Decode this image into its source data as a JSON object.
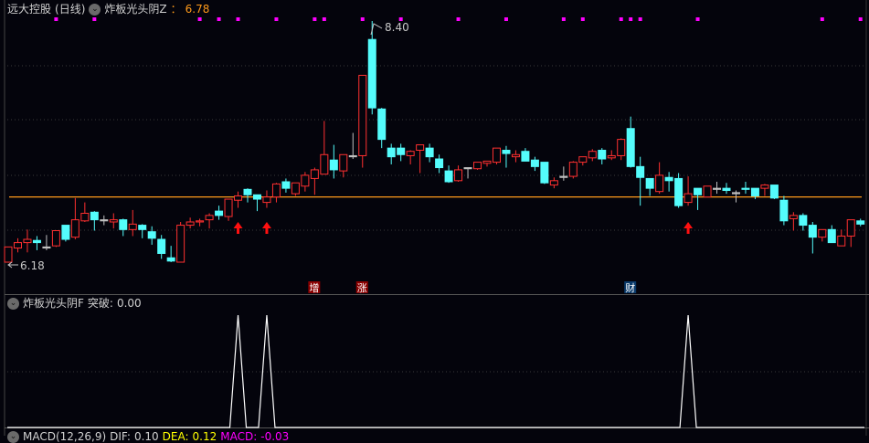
{
  "header": {
    "stock": "远大控股",
    "period": "(日线)",
    "indicator": "炸板光头阴Z",
    "sep": "：",
    "value": "6.78"
  },
  "lower": {
    "indicator": "炸板光头阴F",
    "label": "突破:",
    "value": "0.00"
  },
  "macd": {
    "name": "MACD(12,26,9)",
    "dif_label": "DIF:",
    "dif": "0.10",
    "dea_label": "DEA:",
    "dea": "0.12",
    "macd_label": "MACD:",
    "macd": "-0.03"
  },
  "chart_data": {
    "type": "candlestick",
    "ylim": [
      6.18,
      8.4
    ],
    "max_label": "8.40",
    "min_label": "6.18",
    "reference_line": 6.78,
    "colors": {
      "up": "#ff3030",
      "down": "#54fcfc",
      "doji": "#c0c0c0",
      "ref": "#ff9a1a",
      "dot": "#ff00ff",
      "arrow": "#ff1010",
      "signal": "#ffffff"
    },
    "ohlc": [
      [
        6.18,
        6.32,
        6.18,
        6.32
      ],
      [
        6.31,
        6.4,
        6.27,
        6.36
      ],
      [
        6.36,
        6.48,
        6.27,
        6.39
      ],
      [
        6.38,
        6.42,
        6.29,
        6.36
      ],
      [
        6.32,
        6.43,
        6.29,
        6.32
      ],
      [
        6.33,
        6.47,
        6.32,
        6.47
      ],
      [
        6.52,
        6.52,
        6.37,
        6.39
      ],
      [
        6.41,
        6.77,
        6.39,
        6.57
      ],
      [
        6.56,
        6.73,
        6.55,
        6.63
      ],
      [
        6.64,
        6.65,
        6.47,
        6.57
      ],
      [
        6.57,
        6.61,
        6.52,
        6.57
      ],
      [
        6.55,
        6.63,
        6.49,
        6.57
      ],
      [
        6.57,
        6.58,
        6.42,
        6.48
      ],
      [
        6.48,
        6.66,
        6.42,
        6.53
      ],
      [
        6.52,
        6.53,
        6.4,
        6.48
      ],
      [
        6.46,
        6.51,
        6.34,
        6.4
      ],
      [
        6.39,
        6.43,
        6.21,
        6.26
      ],
      [
        6.22,
        6.33,
        6.18,
        6.19
      ],
      [
        6.18,
        6.55,
        6.18,
        6.52
      ],
      [
        6.52,
        6.59,
        6.49,
        6.55
      ],
      [
        6.55,
        6.58,
        6.51,
        6.56
      ],
      [
        6.57,
        6.63,
        6.49,
        6.61
      ],
      [
        6.65,
        6.7,
        6.57,
        6.61
      ],
      [
        6.6,
        6.76,
        6.56,
        6.76
      ],
      [
        6.75,
        6.83,
        6.68,
        6.79
      ],
      [
        6.85,
        6.86,
        6.73,
        6.8
      ],
      [
        6.8,
        6.8,
        6.65,
        6.76
      ],
      [
        6.73,
        6.84,
        6.68,
        6.78
      ],
      [
        6.78,
        6.91,
        6.73,
        6.9
      ],
      [
        6.92,
        6.95,
        6.82,
        6.86
      ],
      [
        6.81,
        6.91,
        6.79,
        6.91
      ],
      [
        6.88,
        7.01,
        6.83,
        6.98
      ],
      [
        6.95,
        7.05,
        6.8,
        7.03
      ],
      [
        6.99,
        7.48,
        6.99,
        7.17
      ],
      [
        7.12,
        7.26,
        6.95,
        7.03
      ],
      [
        7.02,
        7.17,
        6.96,
        7.17
      ],
      [
        7.16,
        7.37,
        7.13,
        7.16
      ],
      [
        7.16,
        7.9,
        7.05,
        7.9
      ],
      [
        8.23,
        8.4,
        7.54,
        7.6
      ],
      [
        7.59,
        7.6,
        7.23,
        7.31
      ],
      [
        7.23,
        7.27,
        7.08,
        7.15
      ],
      [
        7.23,
        7.27,
        7.11,
        7.17
      ],
      [
        7.16,
        7.21,
        7.08,
        7.2
      ],
      [
        7.21,
        7.26,
        7.0,
        7.26
      ],
      [
        7.23,
        7.27,
        7.1,
        7.15
      ],
      [
        7.13,
        7.17,
        7.0,
        7.05
      ],
      [
        7.02,
        7.07,
        6.91,
        6.92
      ],
      [
        6.93,
        7.07,
        6.92,
        7.03
      ],
      [
        7.05,
        7.05,
        6.95,
        7.05
      ],
      [
        7.04,
        7.1,
        7.03,
        7.1
      ],
      [
        7.09,
        7.11,
        7.06,
        7.11
      ],
      [
        7.1,
        7.23,
        7.08,
        7.23
      ],
      [
        7.21,
        7.25,
        7.05,
        7.18
      ],
      [
        7.15,
        7.21,
        7.1,
        7.17
      ],
      [
        7.2,
        7.23,
        7.11,
        7.11
      ],
      [
        7.12,
        7.15,
        7.02,
        7.06
      ],
      [
        7.1,
        7.1,
        6.9,
        6.91
      ],
      [
        6.89,
        6.96,
        6.86,
        6.93
      ],
      [
        6.97,
        7.06,
        6.93,
        6.97
      ],
      [
        6.97,
        7.11,
        6.95,
        7.1
      ],
      [
        7.1,
        7.15,
        7.07,
        7.15
      ],
      [
        7.14,
        7.22,
        7.11,
        7.2
      ],
      [
        7.21,
        7.23,
        7.08,
        7.13
      ],
      [
        7.14,
        7.21,
        7.12,
        7.16
      ],
      [
        7.16,
        7.32,
        7.12,
        7.31
      ],
      [
        7.41,
        7.52,
        7.05,
        7.06
      ],
      [
        7.06,
        7.15,
        6.7,
        6.96
      ],
      [
        6.95,
        6.95,
        6.79,
        6.86
      ],
      [
        6.83,
        7.1,
        6.81,
        6.98
      ],
      [
        6.96,
        7.01,
        6.83,
        6.93
      ],
      [
        6.95,
        7.0,
        6.68,
        6.7
      ],
      [
        6.73,
        6.97,
        6.7,
        6.81
      ],
      [
        6.86,
        6.86,
        6.66,
        6.8
      ],
      [
        6.78,
        6.88,
        6.78,
        6.88
      ],
      [
        6.86,
        6.92,
        6.81,
        6.86
      ],
      [
        6.86,
        6.91,
        6.81,
        6.84
      ],
      [
        6.82,
        6.84,
        6.73,
        6.82
      ],
      [
        6.86,
        6.92,
        6.81,
        6.86
      ],
      [
        6.86,
        6.86,
        6.76,
        6.79
      ],
      [
        6.86,
        6.9,
        6.79,
        6.89
      ],
      [
        6.89,
        6.89,
        6.76,
        6.77
      ],
      [
        6.75,
        6.79,
        6.52,
        6.56
      ],
      [
        6.58,
        6.64,
        6.47,
        6.61
      ],
      [
        6.61,
        6.63,
        6.47,
        6.52
      ],
      [
        6.52,
        6.55,
        6.26,
        6.41
      ],
      [
        6.41,
        6.48,
        6.37,
        6.48
      ],
      [
        6.48,
        6.52,
        6.36,
        6.36
      ],
      [
        6.33,
        6.48,
        6.33,
        6.42
      ],
      [
        6.42,
        6.57,
        6.32,
        6.57
      ],
      [
        6.56,
        6.58,
        6.51,
        6.53
      ]
    ],
    "top_dot_indices": [
      6,
      10,
      21,
      23,
      25,
      29,
      33,
      34,
      38,
      42,
      48,
      53,
      59,
      61,
      65,
      66,
      67,
      73,
      86,
      90
    ],
    "arrow_indices": [
      25,
      28,
      72
    ],
    "signal_indices": [
      25,
      28,
      72
    ],
    "signal_ylim": [
      0,
      1
    ],
    "event_labels": [
      {
        "index": 33,
        "text": "增",
        "bg": "#8a0000"
      },
      {
        "index": 38,
        "text": "涨",
        "bg": "#8a0000"
      },
      {
        "index": 66,
        "text": "财",
        "bg": "#0a3a6a"
      }
    ]
  }
}
